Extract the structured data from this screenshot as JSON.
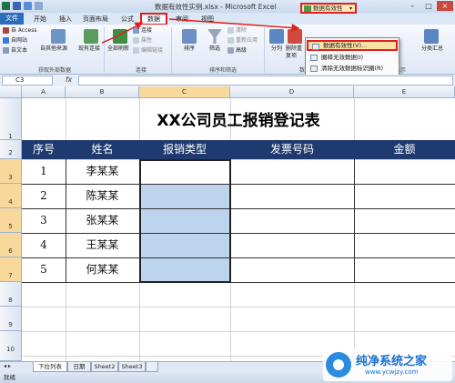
{
  "window": {
    "title": "数据有效性实例.xlsx - Microsoft Excel"
  },
  "tabs": [
    {
      "label": "文件"
    },
    {
      "label": "开始"
    },
    {
      "label": "插入"
    },
    {
      "label": "页面布局"
    },
    {
      "label": "公式"
    },
    {
      "label": "数据"
    },
    {
      "label": "审阅"
    },
    {
      "label": "视图"
    }
  ],
  "ribbon": {
    "get_external": {
      "items": [
        "自 Access",
        "自网站",
        "自文本"
      ],
      "other_sources": "自其他来源",
      "existing": "现有连接",
      "label": "获取外部数据"
    },
    "connections": {
      "refresh_all": "全部刷新",
      "items": [
        "连接",
        "属性",
        "编辑链接"
      ],
      "label": "连接"
    },
    "sort_filter": {
      "sort": "排序",
      "filter": "筛选",
      "items": [
        "清除",
        "重新应用",
        "高级"
      ],
      "label": "排序和筛选"
    },
    "data_tools": {
      "text_to_columns": "分列",
      "remove_dup": "删除重复项",
      "label": "数",
      "data_validation": "数据有效性",
      "menu": [
        "数据有效性(V)...",
        "圈释无效数据(I)",
        "清除无效数据标识圈(R)"
      ]
    },
    "outline": {
      "subtotal": "分类汇总",
      "label": "显示"
    }
  },
  "formula_bar": {
    "name_box": "C3",
    "fx": "fx",
    "value": ""
  },
  "columns": [
    "A",
    "B",
    "C",
    "D",
    "E"
  ],
  "rows": [
    "1",
    "2",
    "3",
    "4",
    "5",
    "6",
    "7",
    "8",
    "9",
    "10"
  ],
  "sheet": {
    "title": "XX公司员工报销登记表",
    "headers": [
      "序号",
      "姓名",
      "报销类型",
      "发票号码",
      "金额"
    ],
    "records": [
      {
        "no": "1",
        "name": "李某某"
      },
      {
        "no": "2",
        "name": "陈某某"
      },
      {
        "no": "3",
        "name": "张某某"
      },
      {
        "no": "4",
        "name": "王某某"
      },
      {
        "no": "5",
        "name": "何某某"
      }
    ]
  },
  "sheet_tabs": [
    "下拉列表",
    "日期",
    "Sheet2",
    "Sheet3"
  ],
  "status": "就绪",
  "watermark": {
    "title": "纯净系统之家",
    "url": "www.ycwjzy.com"
  }
}
